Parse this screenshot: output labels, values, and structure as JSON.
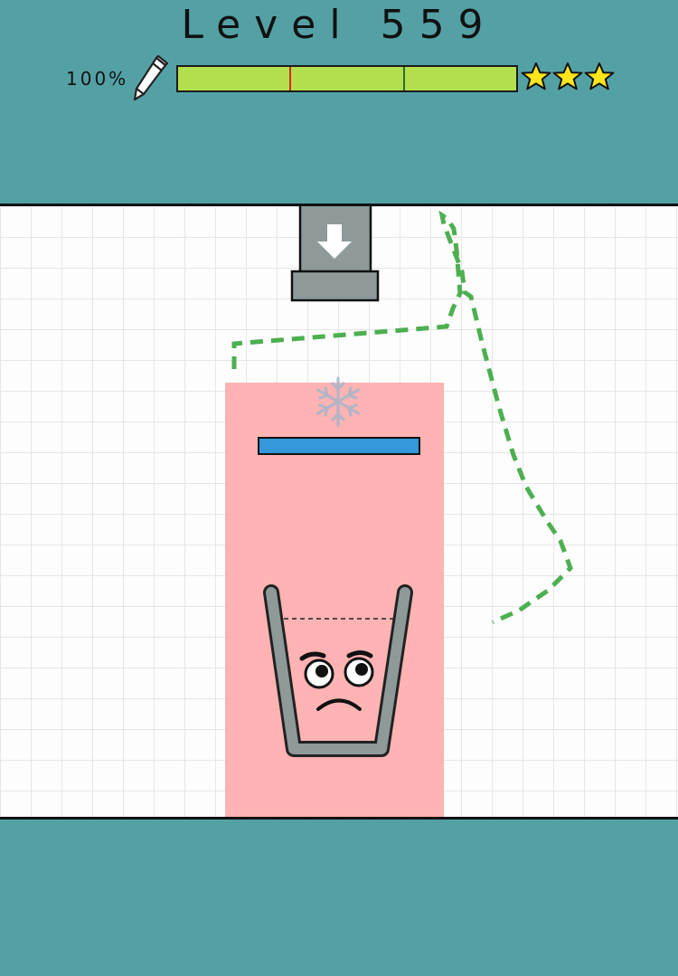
{
  "level": {
    "label": "Level 559"
  },
  "ink": {
    "percent_label": "100%",
    "fill_fraction": 1.0,
    "fill_color": "#b3df4f",
    "markers": [
      {
        "position_fraction": 0.33,
        "color": "#d62a1e"
      },
      {
        "position_fraction": 0.667,
        "color": "#2f6b2f"
      }
    ],
    "icon": "pencil-icon"
  },
  "rating": {
    "stars_earned": 3,
    "stars_total": 3,
    "star_color": "#ffe51c"
  },
  "colors": {
    "background": "#54a1a5",
    "hazard_zone": "#ffafaf",
    "drawn_line": "#4caf50",
    "platform": "#3498db",
    "metal_gray": "#8e9a9a"
  },
  "objects": {
    "dispenser": {
      "icon": "down-arrow-icon"
    },
    "freeze_item": {
      "icon": "snowflake-icon"
    },
    "cup": {
      "face": "worried-face"
    }
  }
}
